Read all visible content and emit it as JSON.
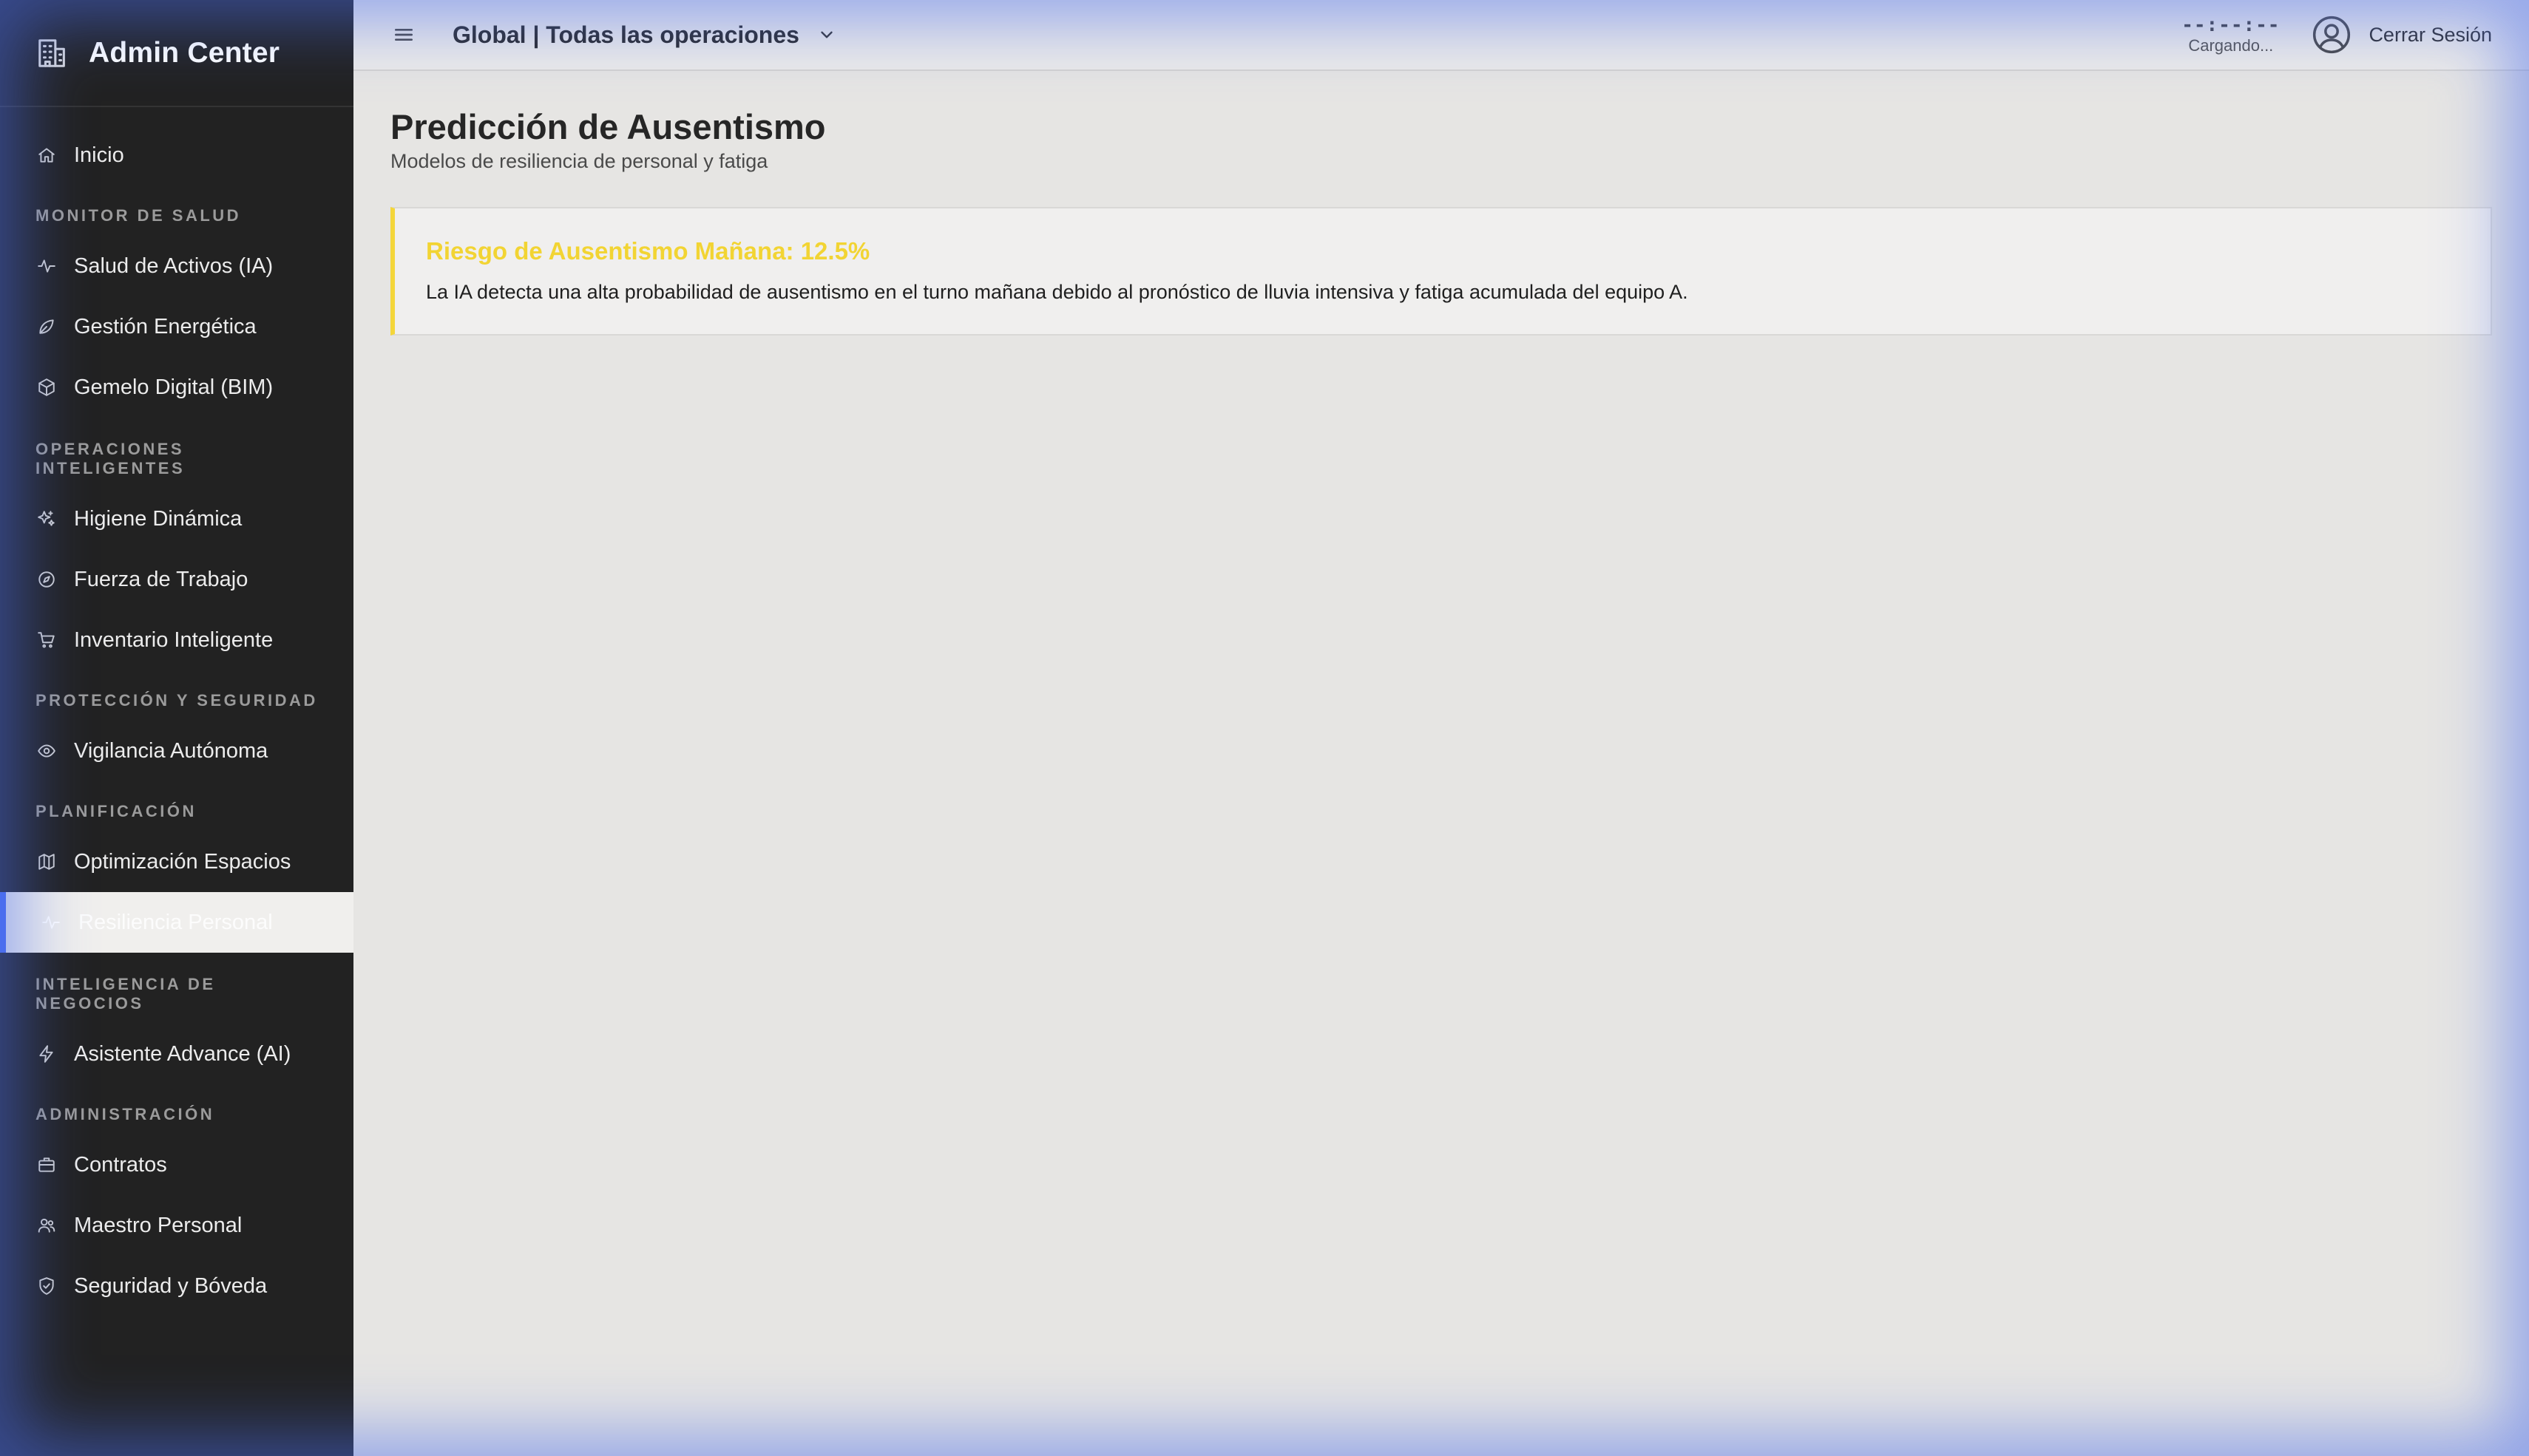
{
  "brand": {
    "title": "Admin Center",
    "icon": "building-icon"
  },
  "sidebar": {
    "home": {
      "label": "Inicio",
      "icon": "home-icon"
    },
    "sections": [
      {
        "title": "MONITOR DE SALUD",
        "items": [
          {
            "label": "Salud de Activos (IA)",
            "icon": "pulse-icon"
          },
          {
            "label": "Gestión Energética",
            "icon": "leaf-icon"
          },
          {
            "label": "Gemelo Digital (BIM)",
            "icon": "cube-icon"
          }
        ]
      },
      {
        "title": "OPERACIONES INTELIGENTES",
        "items": [
          {
            "label": "Higiene Dinámica",
            "icon": "sparkles-icon"
          },
          {
            "label": "Fuerza de Trabajo",
            "icon": "compass-icon"
          },
          {
            "label": "Inventario Inteligente",
            "icon": "cart-icon"
          }
        ]
      },
      {
        "title": "PROTECCIÓN Y SEGURIDAD",
        "items": [
          {
            "label": "Vigilancia Autónoma",
            "icon": "eye-icon"
          }
        ]
      },
      {
        "title": "PLANIFICACIÓN",
        "items": [
          {
            "label": "Optimización Espacios",
            "icon": "map-icon"
          },
          {
            "label": "Resiliencia Personal",
            "icon": "activity-icon",
            "active": true
          }
        ]
      },
      {
        "title": "INTELIGENCIA DE NEGOCIOS",
        "items": [
          {
            "label": "Asistente Advance (AI)",
            "icon": "bolt-icon"
          }
        ]
      },
      {
        "title": "ADMINISTRACIÓN",
        "items": [
          {
            "label": "Contratos",
            "icon": "briefcase-icon"
          },
          {
            "label": "Maestro Personal",
            "icon": "users-icon"
          },
          {
            "label": "Seguridad y Bóveda",
            "icon": "shield-icon"
          }
        ]
      }
    ]
  },
  "topbar": {
    "scope": "Global | Todas las operaciones",
    "clock_time": "--:--:--",
    "clock_status": "Cargando...",
    "logout": "Cerrar Sesión"
  },
  "page": {
    "title": "Predicción de Ausentismo",
    "subtitle": "Modelos de resiliencia de personal y fatiga"
  },
  "alert": {
    "title": "Riesgo de Ausentismo Mañana: 12.5%",
    "body": "La IA detecta una alta probabilidad de ausentismo en el turno mañana debido al pronóstico de lluvia intensiva y fatiga acumulada del equipo A.",
    "color": "#f2d433"
  },
  "colors": {
    "sidebar_bg": "#222222",
    "accent": "#4b6ef0",
    "alert_accent": "#f4d63a"
  }
}
